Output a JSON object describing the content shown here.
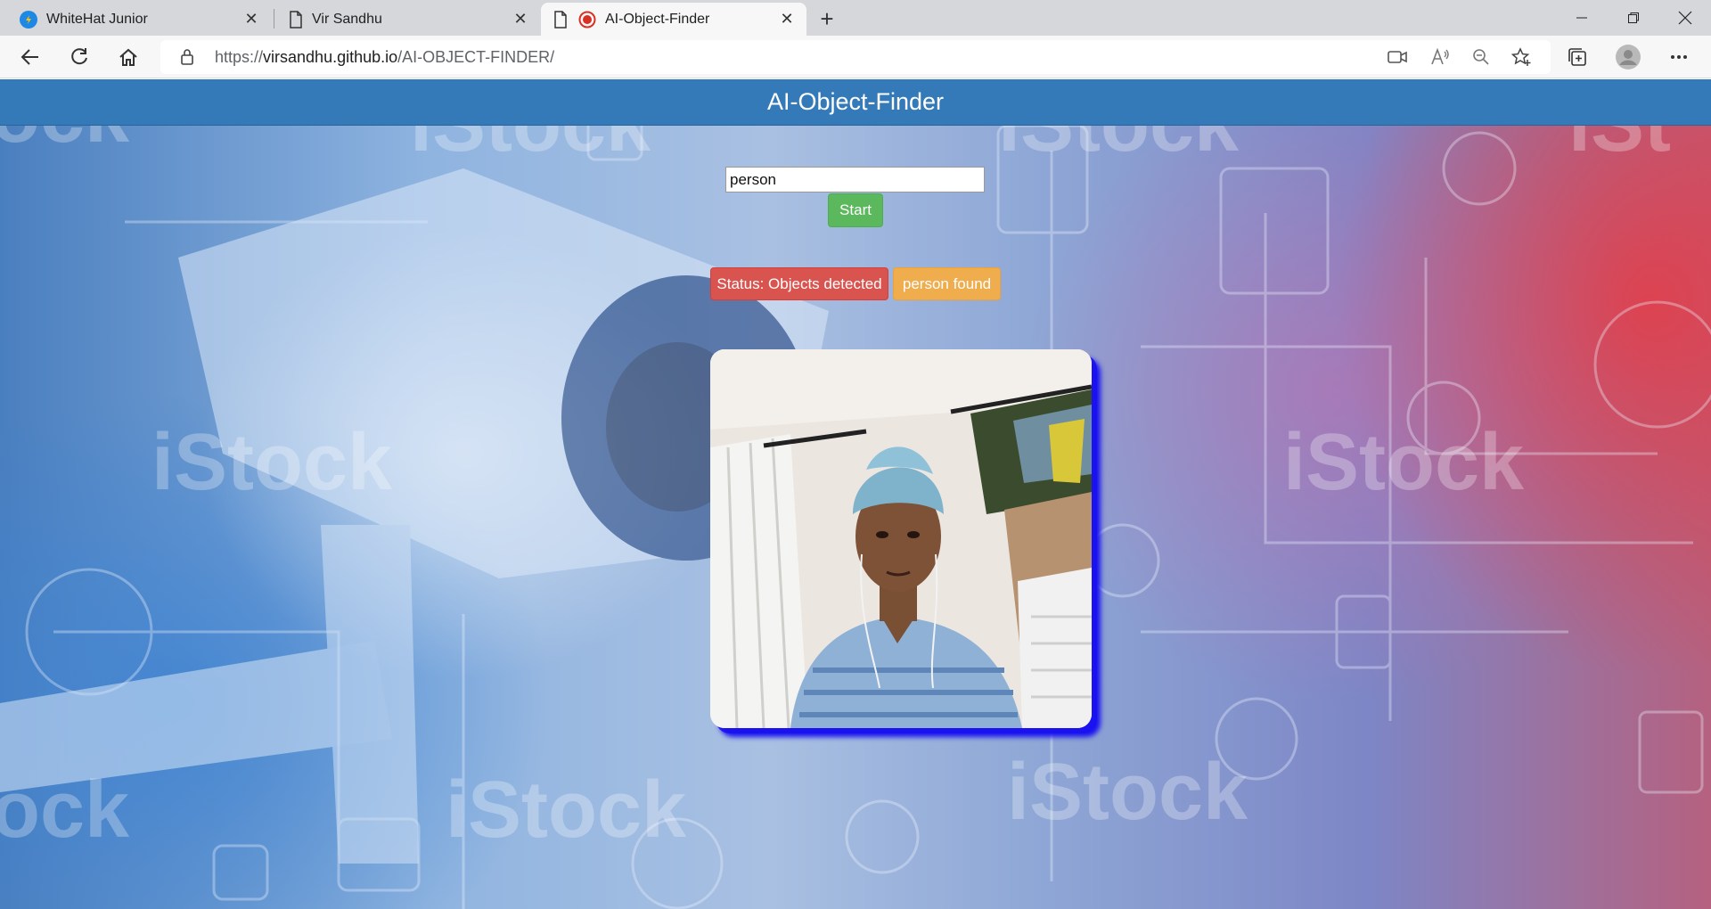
{
  "browser": {
    "tabs": [
      {
        "title": "WhiteHat Junior",
        "icon": "whitehat-logo-icon",
        "active": false
      },
      {
        "title": "Vir Sandhu",
        "icon": "page-icon",
        "active": false
      },
      {
        "title": "AI-Object-Finder",
        "icon": "page-icon",
        "active": true,
        "recording": true
      }
    ],
    "address": {
      "prefix": "https://",
      "host": "virsandhu.github.io",
      "path": "/AI-OBJECT-FINDER/"
    }
  },
  "app": {
    "title": "AI-Object-Finder",
    "search": {
      "value": "person",
      "placeholder": ""
    },
    "start_label": "Start",
    "status_text": "Status: Objects detected",
    "found_text": "person found"
  },
  "colors": {
    "header": "#347ab8",
    "start_button": "#5cb85c",
    "status_badge": "#d9534f",
    "found_badge": "#f0ad4e",
    "video_shadow": "#1a12f0"
  }
}
